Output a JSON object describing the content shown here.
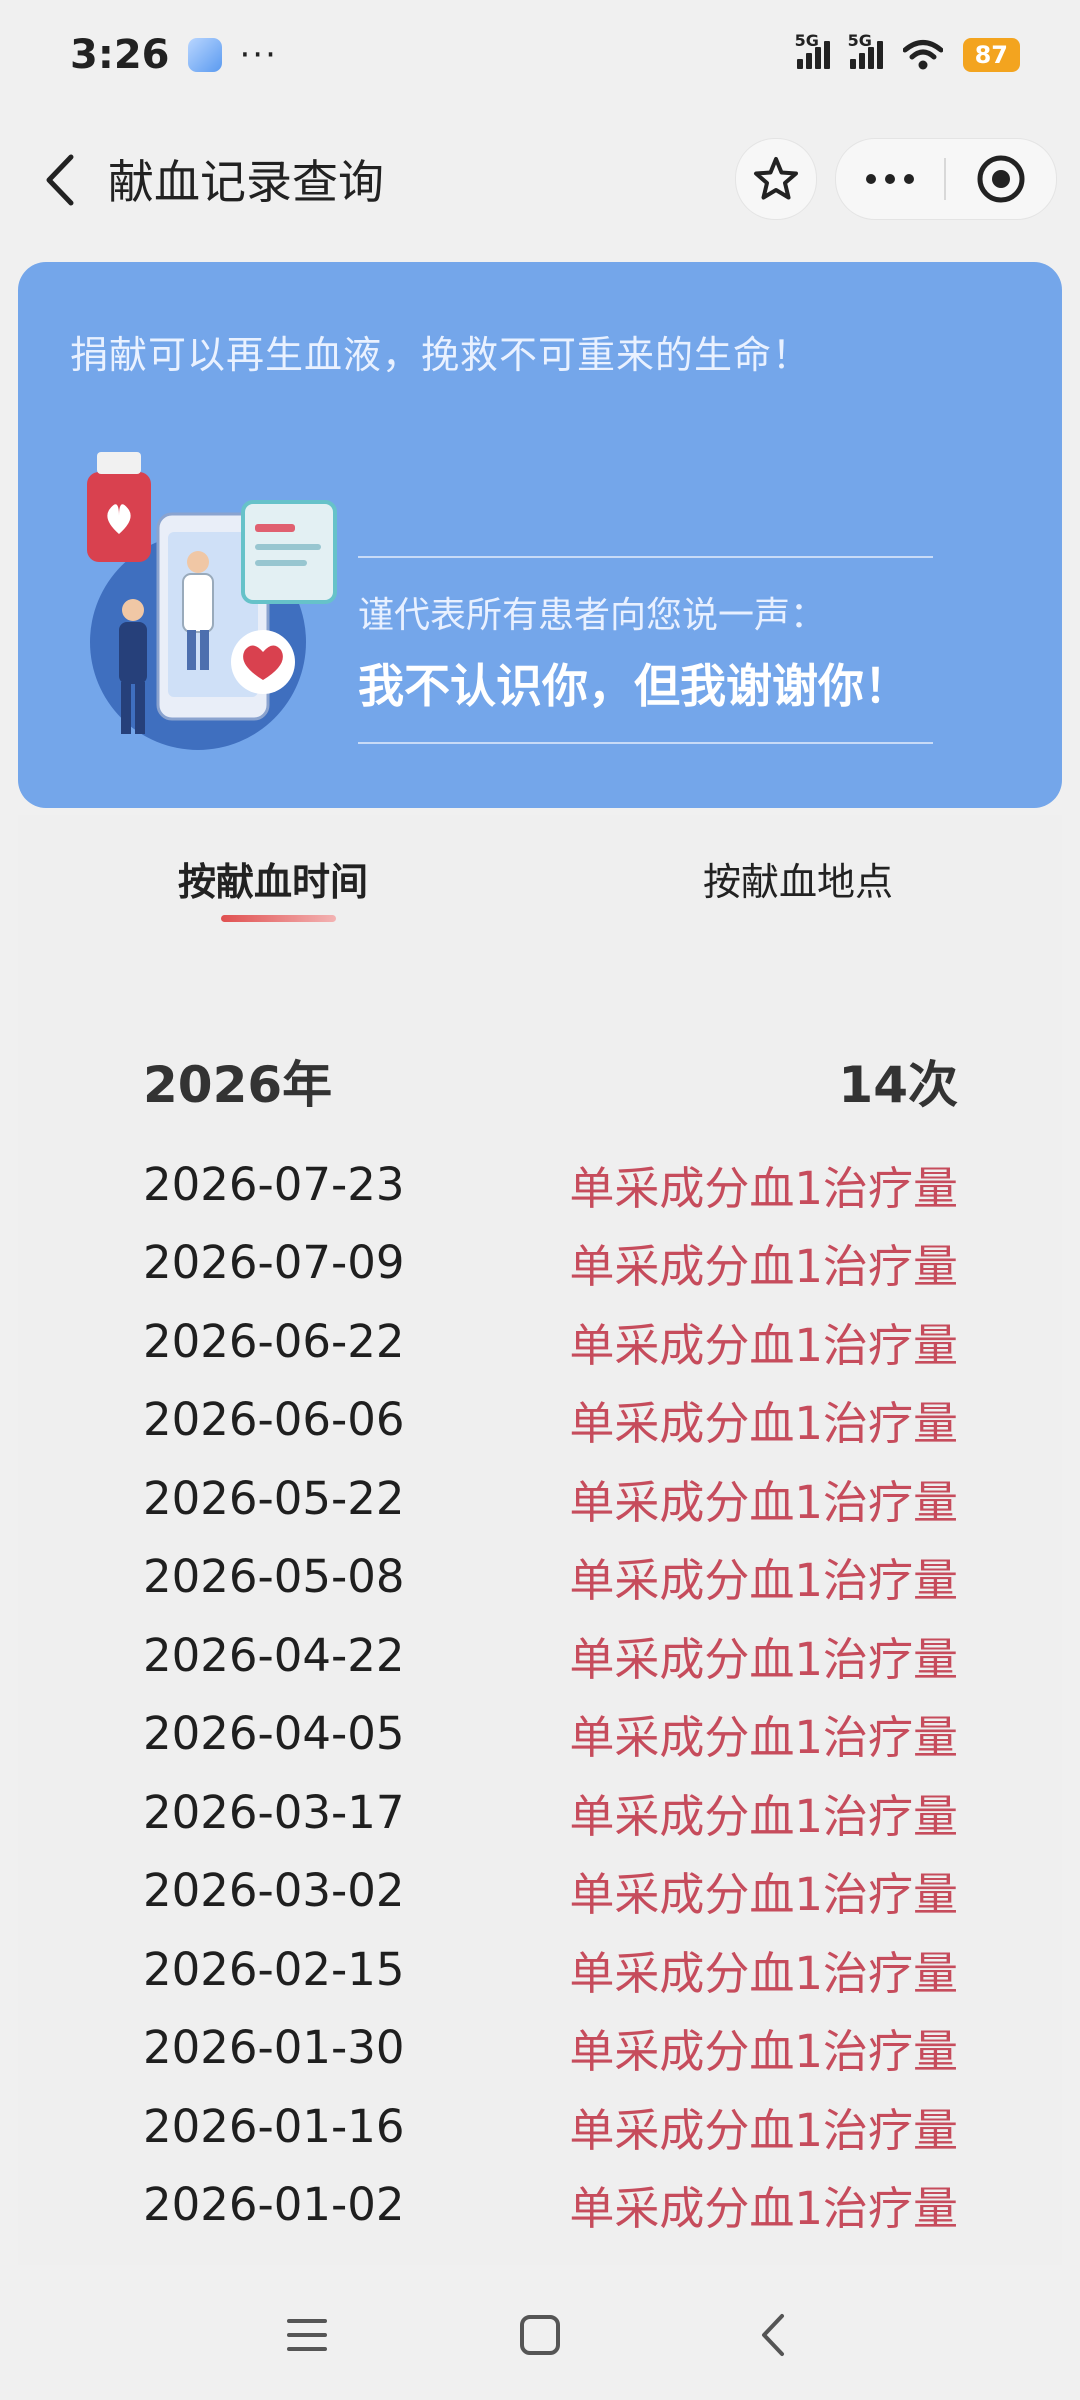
{
  "status_bar": {
    "time": "3:26",
    "dots": "···",
    "signal_1": "5G",
    "signal_2": "5G",
    "battery": "87",
    "battery_color": "#f3a41f"
  },
  "nav": {
    "title": "献血记录查询",
    "back_icon": "chevron-left-icon",
    "star_icon": "star-icon",
    "more_icon": "more-dots-icon",
    "close_icon": "target-circle-icon"
  },
  "banner": {
    "slogan": "捐献可以再生血液，挽救不可重来的生命！",
    "thanks_sub": "谨代表所有患者向您说一声：",
    "thanks_main": "我不认识你，但我谢谢你！",
    "background_color": "#74a6ea"
  },
  "tabs": [
    {
      "label": "按献血时间",
      "active": true
    },
    {
      "label": "按献血地点",
      "active": false
    }
  ],
  "summary": {
    "year": "2026年",
    "count": "14次"
  },
  "records": [
    {
      "date": "2026-07-23",
      "type": "单采成分血1治疗量"
    },
    {
      "date": "2026-07-09",
      "type": "单采成分血1治疗量"
    },
    {
      "date": "2026-06-22",
      "type": "单采成分血1治疗量"
    },
    {
      "date": "2026-06-06",
      "type": "单采成分血1治疗量"
    },
    {
      "date": "2026-05-22",
      "type": "单采成分血1治疗量"
    },
    {
      "date": "2026-05-08",
      "type": "单采成分血1治疗量"
    },
    {
      "date": "2026-04-22",
      "type": "单采成分血1治疗量"
    },
    {
      "date": "2026-04-05",
      "type": "单采成分血1治疗量"
    },
    {
      "date": "2026-03-17",
      "type": "单采成分血1治疗量"
    },
    {
      "date": "2026-03-02",
      "type": "单采成分血1治疗量"
    },
    {
      "date": "2026-02-15",
      "type": "单采成分血1治疗量"
    },
    {
      "date": "2026-01-30",
      "type": "单采成分血1治疗量"
    },
    {
      "date": "2026-01-16",
      "type": "单采成分血1治疗量"
    },
    {
      "date": "2026-01-02",
      "type": "单采成分血1治疗量"
    }
  ],
  "colors": {
    "record_type": "#c64c5c",
    "tab_underline": "#e05050"
  },
  "system_nav": {
    "menu_icon": "menu-icon",
    "home_icon": "home-square-icon",
    "back_icon": "back-chevron-icon"
  }
}
